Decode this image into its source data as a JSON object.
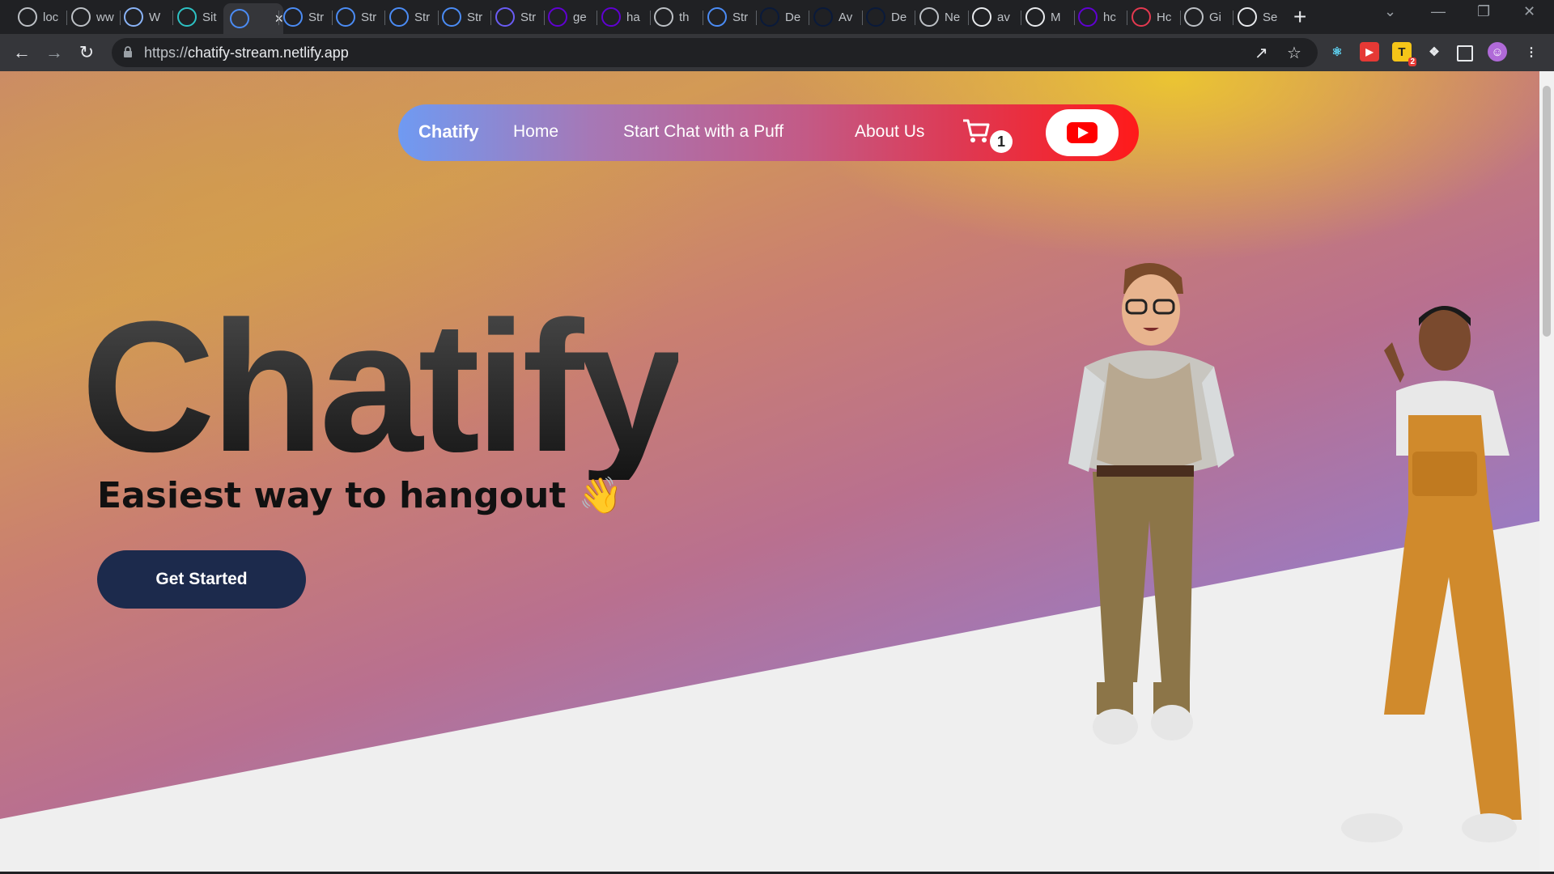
{
  "browser": {
    "tabs": [
      {
        "title": "loc",
        "icon": "crown-icon",
        "color": "#bdc1c6"
      },
      {
        "title": "ww",
        "icon": "globe-icon",
        "color": "#bdc1c6"
      },
      {
        "title": "W",
        "icon": "wordpress-icon",
        "color": "#8ab4f8"
      },
      {
        "title": "Sit",
        "icon": "netlify-icon",
        "color": "#2dc2c4"
      },
      {
        "title": "",
        "icon": "crown-icon",
        "color": "#4b8cf5",
        "active": true
      },
      {
        "title": "Str",
        "icon": "crown-icon",
        "color": "#4b8cf5"
      },
      {
        "title": "Str",
        "icon": "crown-icon",
        "color": "#4b8cf5"
      },
      {
        "title": "Str",
        "icon": "crown-icon",
        "color": "#4b8cf5"
      },
      {
        "title": "Str",
        "icon": "crown-icon",
        "color": "#4b8cf5"
      },
      {
        "title": "Str",
        "icon": "s-icon",
        "color": "#6a5cf5"
      },
      {
        "title": "ge",
        "icon": "yahoo-icon",
        "color": "#6001d2"
      },
      {
        "title": "ha",
        "icon": "yahoo-icon",
        "color": "#6001d2"
      },
      {
        "title": "th",
        "icon": "globe-icon",
        "color": "#bdc1c6"
      },
      {
        "title": "Str",
        "icon": "crown-icon",
        "color": "#4b8cf5"
      },
      {
        "title": "De",
        "icon": "d-icon",
        "color": "#0a1a3a"
      },
      {
        "title": "Av",
        "icon": "d-icon",
        "color": "#0a1a3a"
      },
      {
        "title": "De",
        "icon": "d-icon",
        "color": "#0a1a3a"
      },
      {
        "title": "Ne",
        "icon": "globe-icon",
        "color": "#bdc1c6"
      },
      {
        "title": "av",
        "icon": "github-icon",
        "color": "#e8eaed"
      },
      {
        "title": "M",
        "icon": "github-icon",
        "color": "#e8eaed"
      },
      {
        "title": "hc",
        "icon": "yahoo-icon",
        "color": "#6001d2"
      },
      {
        "title": "Hc",
        "icon": "music-icon",
        "color": "#e53950"
      },
      {
        "title": "Gi",
        "icon": "globe-icon",
        "color": "#bdc1c6"
      },
      {
        "title": "Se",
        "icon": "gear-icon",
        "color": "#e8eaed"
      }
    ],
    "url_scheme": "https://",
    "url_host": "chatify-stream.netlify.app",
    "extension_badge": "2"
  },
  "nav": {
    "brand": "Chatify",
    "links": [
      "Home",
      "Start Chat with a Puff",
      "About Us"
    ],
    "cart_count": "1",
    "youtube_icon": "youtube-icon"
  },
  "hero": {
    "title": "Chatify",
    "tagline": "Easiest way to hangout 👋",
    "cta": "Get Started"
  },
  "colors": {
    "nav_gradient_start": "#6f9af2",
    "nav_gradient_end": "#ff1a1a",
    "cta_bg": "#1c2a4c"
  }
}
